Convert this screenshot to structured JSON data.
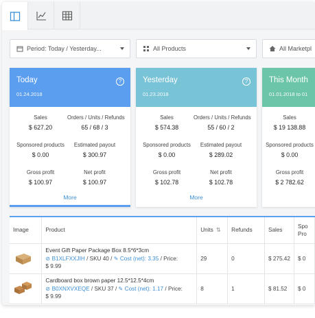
{
  "tabs": [
    {
      "name": "sidebar-view-icon"
    },
    {
      "name": "chart-icon"
    },
    {
      "name": "grid-icon"
    }
  ],
  "filters": {
    "period": "Period: Today / Yesterday...",
    "products": "All Products",
    "marketplaces": "All Marketpl"
  },
  "cards": [
    {
      "title": "Today",
      "date": "01.24.2018",
      "color": "#5b9ef0",
      "help": "?",
      "sales_label": "Sales",
      "sales": "$ 627.20",
      "orders_label": "Orders / Units / Refunds",
      "orders": "65 / 68 / 3",
      "ads_label": "Sponsored products",
      "ads": "$ 0.00",
      "payout_label": "Estimated payout",
      "payout": "$ 300.97",
      "gross_label": "Gross profit",
      "gross": "$ 100.97",
      "net_label": "Net profit",
      "net": "$ 100.97",
      "more": "More"
    },
    {
      "title": "Yesterday",
      "date": "01.23.2018",
      "color": "#79c3d6",
      "help": "?",
      "sales_label": "Sales",
      "sales": "$ 574.38",
      "orders_label": "Orders / Units / Refunds",
      "orders": "55 / 60 / 2",
      "ads_label": "Sponsored products",
      "ads": "$ 0.00",
      "payout_label": "Estimated payout",
      "payout": "$ 289.02",
      "gross_label": "Gross profit",
      "gross": "$ 102.78",
      "net_label": "Net profit",
      "net": "$ 102.78",
      "more": "More"
    },
    {
      "title": "This Month",
      "date": "01.01.2018 to 01",
      "color": "#6cc5a8",
      "sales_label": "Sales",
      "sales": "$ 19 138.88",
      "ads_label": "Sponsored products",
      "ads": "$ 0.00",
      "gross_label": "Gross profit",
      "gross": "$ 2 782.62"
    }
  ],
  "table": {
    "headers": [
      "Image",
      "Product",
      "Units",
      "Refunds",
      "Sales",
      "Spo Pro"
    ],
    "rows": [
      {
        "name": "Event Gift Paper Package Box 8.5*6*3cm",
        "asin": "B1XLFXXJIH",
        "sku_label": "/ SKU 40 /",
        "cost": "Cost (net): 3.35",
        "price_label": "/ Price:",
        "price": "$ 9.99",
        "units": "29",
        "refunds": "0",
        "sales": "$ 275.42",
        "spo": "$ 0"
      },
      {
        "name": "Cardboard box brown paper 12.5*12.5*4cm",
        "asin": "B0XNXVXEQE",
        "sku_label": "/ SKU 37 /",
        "cost": "Cost (net): 1.17",
        "price_label": "/ Price:",
        "price": "$ 9.99",
        "units": "8",
        "refunds": "1",
        "sales": "$ 81.52",
        "spo": "$ 0"
      }
    ]
  }
}
